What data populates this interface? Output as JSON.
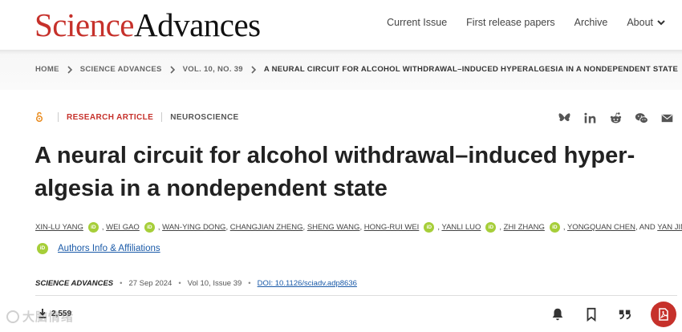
{
  "header": {
    "logo_science": "Science",
    "logo_advances": "Advances",
    "nav": [
      "Current Issue",
      "First release papers",
      "Archive",
      "About"
    ]
  },
  "breadcrumb": [
    "HOME",
    "SCIENCE ADVANCES",
    "VOL. 10, NO. 39",
    "A NEURAL CIRCUIT FOR ALCOHOL WITHDRAWAL–INDUCED HYPERALGESIA IN A NONDEPENDENT STATE"
  ],
  "article": {
    "type": "RESEARCH ARTICLE",
    "subject": "NEUROSCIENCE",
    "title": "A neural circuit for alcohol withdrawal–induced hyper-algesia in a nondependent state",
    "orcid_label": "iD",
    "authors": [
      "XIN-LU YANG",
      "WEI GAO",
      "WAN-YING DONG",
      "CHANGJIAN ZHENG",
      "SHENG WANG",
      "HONG-RUI WEI",
      "YANLI LUO",
      "ZHI ZHANG",
      "YONGQUAN CHEN",
      "YAN JIN"
    ],
    "authors_and": ", AND",
    "affiliations_link": "Authors Info & Affiliations",
    "journal": "SCIENCE ADVANCES",
    "date": "27 Sep 2024",
    "volume": "Vol 10, Issue 39",
    "doi": "DOI: 10.1126/sciadv.adp8636",
    "downloads": "2,559"
  },
  "share_icons": [
    "bluesky-icon",
    "linkedin-icon",
    "reddit-icon",
    "wechat-icon",
    "email-icon"
  ],
  "tool_icons": [
    "alert-bell-icon",
    "bookmark-icon",
    "cite-quote-icon",
    "pdf-icon"
  ],
  "watermark": "大脑情绪",
  "colors": {
    "brand_red": "#c6312b",
    "link_blue": "#1a5aa8",
    "orcid_green": "#a6ce39"
  }
}
